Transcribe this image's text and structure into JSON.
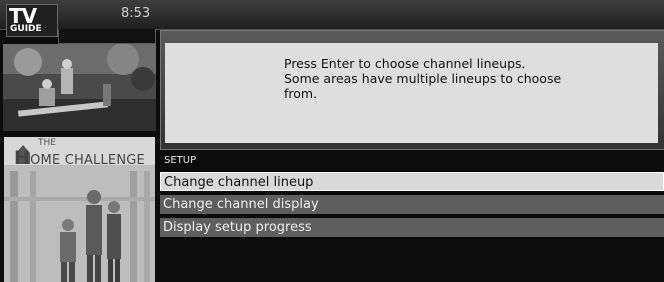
{
  "header": {
    "logo_tv": "TV",
    "logo_guide": "GUIDE",
    "clock": "8:53"
  },
  "promo": {
    "the": "THE",
    "title_first": "H",
    "title_rest": "OME CHALLENGE"
  },
  "info": {
    "lines": [
      "Press Enter to choose channel lineups.",
      "Some areas have multiple lineups to choose",
      "from."
    ]
  },
  "setup": {
    "title": "SETUP",
    "items": [
      {
        "label": "Change channel lineup",
        "state": "selected"
      },
      {
        "label": "Change channel display",
        "state": "normal"
      },
      {
        "label": "Display setup progress",
        "state": "normal"
      }
    ]
  },
  "colors": {
    "selected_bg": "#d9d9d9",
    "item_bg": "#5e5e5e",
    "info_bg": "#dedede"
  }
}
